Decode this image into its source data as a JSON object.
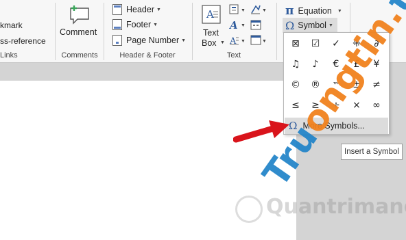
{
  "ribbon": {
    "links_group": {
      "bookmark_label": "kmark",
      "cross_reference_label": "ss-reference",
      "group_label": "Links"
    },
    "comments_group": {
      "comment_label": "Comment",
      "group_label": "Comments"
    },
    "header_footer_group": {
      "header_label": "Header",
      "footer_label": "Footer",
      "page_number_label": "Page Number",
      "group_label": "Header & Footer"
    },
    "text_group": {
      "text_box_line1": "Text",
      "text_box_line2": "Box",
      "group_label": "Text"
    },
    "symbols_group": {
      "equation_label": "Equation",
      "equation_glyph": "π",
      "symbol_label": "Symbol",
      "symbol_glyph": "Ω"
    }
  },
  "symbol_menu": {
    "symbols": [
      "⊠",
      "☑",
      "✓",
      "⁜",
      "∂",
      "♫",
      "♪",
      "€",
      "£",
      "¥",
      "©",
      "®",
      "™",
      "±",
      "≠",
      "≤",
      "≥",
      "÷",
      "×",
      "∞"
    ],
    "more_symbols_glyph": "Ω",
    "more_symbols_label": "More Symbols..."
  },
  "tooltip": {
    "text": "Insert a Symbol"
  },
  "watermark": {
    "main_text_a": "Tru",
    "main_text_b": "ongtin.",
    "main_text_c": "top",
    "logo_text": "Quantrimang"
  },
  "colors": {
    "ribbon_bg": "#f7f7f7",
    "accent_blue": "#2f5b9c",
    "arrow_red": "#d9141b",
    "hover_gray": "#dcdcdc"
  }
}
